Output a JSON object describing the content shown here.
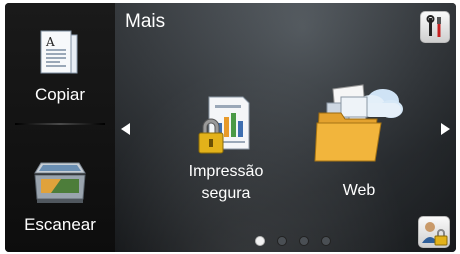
{
  "header": {
    "title": "Mais"
  },
  "sidebar": {
    "items": [
      {
        "label": "Copiar",
        "icon": "copy-document-icon"
      },
      {
        "label": "Escanear",
        "icon": "scanner-icon"
      }
    ]
  },
  "main": {
    "apps": [
      {
        "label_line1": "Impressão",
        "label_line2": "segura",
        "icon": "secure-print-icon"
      },
      {
        "label": "Web",
        "icon": "web-folder-cloud-icon"
      }
    ],
    "pagination": {
      "current_page": 1,
      "total_pages": 4
    }
  },
  "colors": {
    "background": "#000000",
    "panel": "#3a3f44",
    "text": "#ffffff"
  }
}
